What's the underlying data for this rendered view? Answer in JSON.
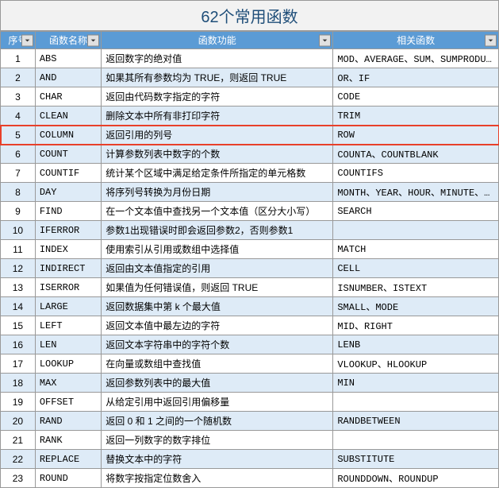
{
  "title": "62个常用函数",
  "headers": [
    "序号",
    "函数名称",
    "函数功能",
    "相关函数"
  ],
  "highlight": 5,
  "rows": [
    {
      "n": 1,
      "name": "ABS",
      "func": "返回数字的绝对值",
      "rel": "MOD、AVERAGE、SUM、SUMPRODUCT"
    },
    {
      "n": 2,
      "name": "AND",
      "func": "如果其所有参数均为 TRUE，则返回 TRUE",
      "rel": "OR、IF"
    },
    {
      "n": 3,
      "name": "CHAR",
      "func": "返回由代码数字指定的字符",
      "rel": "CODE"
    },
    {
      "n": 4,
      "name": "CLEAN",
      "func": "删除文本中所有非打印字符",
      "rel": "TRIM"
    },
    {
      "n": 5,
      "name": "COLUMN",
      "func": "返回引用的列号",
      "rel": "ROW"
    },
    {
      "n": 6,
      "name": "COUNT",
      "func": "计算参数列表中数字的个数",
      "rel": "COUNTA、COUNTBLANK"
    },
    {
      "n": 7,
      "name": "COUNTIF",
      "func": "统计某个区域中满足给定条件所指定的单元格数",
      "rel": "COUNTIFS"
    },
    {
      "n": 8,
      "name": "DAY",
      "func": "将序列号转换为月份日期",
      "rel": "MONTH、YEAR、HOUR、MINUTE、SECOND、NOW"
    },
    {
      "n": 9,
      "name": "FIND",
      "func": "在一个文本值中查找另一个文本值（区分大小写）",
      "rel": "SEARCH"
    },
    {
      "n": 10,
      "name": "IFERROR",
      "func": "参数1出现错误时即会返回参数2，否则参数1",
      "rel": ""
    },
    {
      "n": 11,
      "name": "INDEX",
      "func": "使用索引从引用或数组中选择值",
      "rel": "MATCH"
    },
    {
      "n": 12,
      "name": "INDIRECT",
      "func": "返回由文本值指定的引用",
      "rel": "CELL"
    },
    {
      "n": 13,
      "name": "ISERROR",
      "func": "如果值为任何错误值，则返回 TRUE",
      "rel": "ISNUMBER、ISTEXT"
    },
    {
      "n": 14,
      "name": "LARGE",
      "func": "返回数据集中第 k 个最大值",
      "rel": "SMALL、MODE"
    },
    {
      "n": 15,
      "name": "LEFT",
      "func": "返回文本值中最左边的字符",
      "rel": "MID、RIGHT"
    },
    {
      "n": 16,
      "name": "LEN",
      "func": "返回文本字符串中的字符个数",
      "rel": "LENB"
    },
    {
      "n": 17,
      "name": "LOOKUP",
      "func": "在向量或数组中查找值",
      "rel": "VLOOKUP、HLOOKUP"
    },
    {
      "n": 18,
      "name": "MAX",
      "func": "返回参数列表中的最大值",
      "rel": "MIN"
    },
    {
      "n": 19,
      "name": "OFFSET",
      "func": "从给定引用中返回引用偏移量",
      "rel": ""
    },
    {
      "n": 20,
      "name": "RAND",
      "func": "返回 0 和 1 之间的一个随机数",
      "rel": "RANDBETWEEN"
    },
    {
      "n": 21,
      "name": "RANK",
      "func": "返回一列数字的数字排位",
      "rel": ""
    },
    {
      "n": 22,
      "name": "REPLACE",
      "func": "替换文本中的字符",
      "rel": "SUBSTITUTE"
    },
    {
      "n": 23,
      "name": "ROUND",
      "func": "将数字按指定位数舍入",
      "rel": "ROUNDDOWN、ROUNDUP"
    }
  ]
}
